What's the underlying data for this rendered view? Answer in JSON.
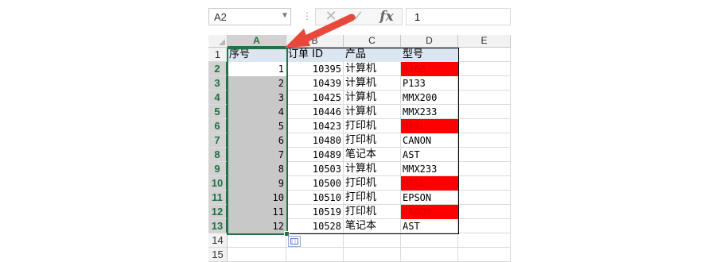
{
  "formula_bar": {
    "name_box": "A2",
    "formula": "1",
    "icons": {
      "cancel": "cancel-x-icon",
      "enter": "checkmark-icon",
      "function": "fx-icon"
    },
    "fx_label": "fx"
  },
  "columns": [
    "A",
    "B",
    "C",
    "D",
    "E"
  ],
  "rows": [
    "1",
    "2",
    "3",
    "4",
    "5",
    "6",
    "7",
    "8",
    "9",
    "10",
    "11",
    "12",
    "13",
    "14",
    "15"
  ],
  "headers": [
    "序号",
    "订单 ID",
    "产品",
    "型号"
  ],
  "table": [
    {
      "seq": "1",
      "order": "10395",
      "product": "计算机",
      "model": "p166",
      "highlight": true
    },
    {
      "seq": "2",
      "order": "10439",
      "product": "计算机",
      "model": "P133",
      "highlight": false
    },
    {
      "seq": "3",
      "order": "10425",
      "product": "计算机",
      "model": "MMX200",
      "highlight": false
    },
    {
      "seq": "4",
      "order": "10446",
      "product": "计算机",
      "model": "MMX233",
      "highlight": false
    },
    {
      "seq": "5",
      "order": "10423",
      "product": "打印机",
      "model": "HP5L",
      "highlight": true
    },
    {
      "seq": "6",
      "order": "10480",
      "product": "打印机",
      "model": "CANON",
      "highlight": false
    },
    {
      "seq": "7",
      "order": "10489",
      "product": "笔记本",
      "model": "AST",
      "highlight": false
    },
    {
      "seq": "8",
      "order": "10503",
      "product": "计算机",
      "model": "MMX233",
      "highlight": false
    },
    {
      "seq": "9",
      "order": "10500",
      "product": "打印机",
      "model": "HP5L",
      "highlight": true
    },
    {
      "seq": "10",
      "order": "10510",
      "product": "打印机",
      "model": "EPSON",
      "highlight": false
    },
    {
      "seq": "11",
      "order": "10519",
      "product": "打印机",
      "model": "CANON",
      "highlight": true
    },
    {
      "seq": "12",
      "order": "10528",
      "product": "笔记本",
      "model": "AST",
      "highlight": false
    }
  ],
  "colors": {
    "selection": "#217346",
    "header_fill": "#dce6f1",
    "highlight_fill": "#ff0000",
    "selected_fill": "#c8c8c8",
    "arrow": "#e8473c"
  },
  "selection": {
    "range": "A2:A13",
    "active_cell": "A2"
  },
  "annotation": {
    "arrow_points_to": "column-A-header"
  },
  "quick_analysis_icon": "quick-analysis-icon"
}
